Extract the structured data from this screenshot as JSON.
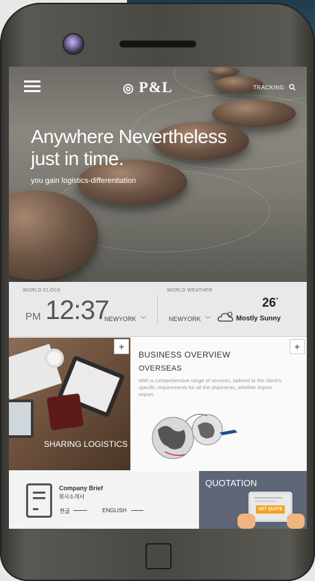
{
  "header": {
    "menu_icon": "hamburger-menu-icon",
    "logo_text": "P&L",
    "tracking_label": "TRACKING",
    "search_icon": "search-icon"
  },
  "hero": {
    "headline": "Anywhere Nevertheless just in time.",
    "subline": "you gain logistics-differentiation"
  },
  "world_clock": {
    "label": "WORLD CLOCK",
    "ampm": "PM",
    "time": "12:37",
    "city": "NEWYORK"
  },
  "world_weather": {
    "label": "WORLD WEATHER",
    "city": "NEWYORK",
    "temperature": "26",
    "degree_symbol": "°",
    "condition": "Mostly Sunny",
    "weather_icon": "cloud-sun-icon"
  },
  "tiles": {
    "sharing": {
      "label": "SHARING LOGISTICS",
      "plus": "+"
    },
    "business": {
      "title": "BUSINESS OVERVIEW",
      "subtitle": "OVERSEAS",
      "description": "With a comprehensive range of services, tailored to the client's specific requirements for all the shipments, whether import, export,",
      "plus": "+"
    },
    "brief": {
      "title": "Company Brief",
      "title_kr": "회사소개서",
      "lang_kr": "한글",
      "lang_en": "ENGLISH"
    },
    "quotation": {
      "label": "QUOTATION",
      "button": "GET QUOTE"
    }
  },
  "colors": {
    "quote_bg": "#5d6577",
    "quote_button": "#f2a31f"
  }
}
